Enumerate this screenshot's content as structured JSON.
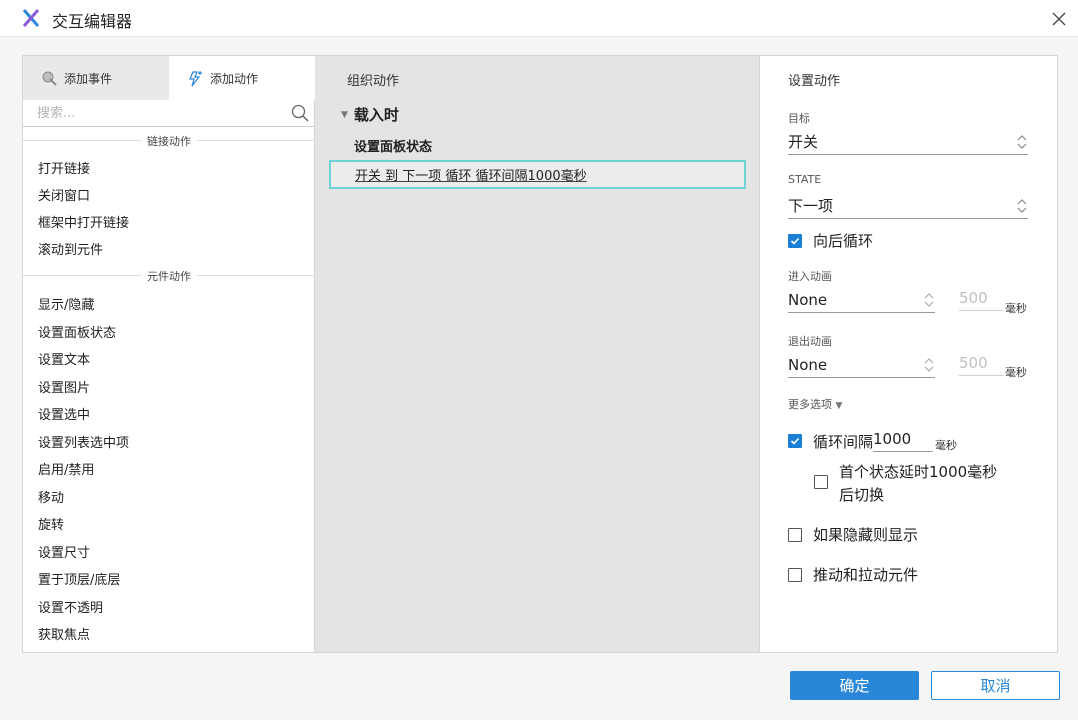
{
  "window": {
    "title": "交互编辑器"
  },
  "left": {
    "tabs": [
      {
        "label": "添加事件",
        "icon": "add-event-icon"
      },
      {
        "label": "添加动作",
        "icon": "add-action-icon"
      }
    ],
    "search_placeholder": "搜索...",
    "sections": [
      {
        "title": "链接动作",
        "items": [
          "打开链接",
          "关闭窗口",
          "框架中打开链接",
          "滚动到元件"
        ]
      },
      {
        "title": "元件动作",
        "items": [
          "显示/隐藏",
          "设置面板状态",
          "设置文本",
          "设置图片",
          "设置选中",
          "设置列表选中项",
          "启用/禁用",
          "移动",
          "旋转",
          "设置尺寸",
          "置于顶层/底层",
          "设置不透明",
          "获取焦点"
        ]
      }
    ]
  },
  "middle": {
    "title": "组织动作",
    "event": "载入时",
    "action_title": "设置面板状态",
    "action_detail": "开关 到 下一项 循环 循环间隔1000毫秒"
  },
  "right": {
    "title": "设置动作",
    "target_label": "目标",
    "target_value": "开关",
    "state_label": "STATE",
    "state_value": "下一项",
    "wrap_label": "向后循环",
    "enter_anim_label": "进入动画",
    "enter_anim_value": "None",
    "enter_duration": "500",
    "exit_anim_label": "退出动画",
    "exit_anim_value": "None",
    "exit_duration": "500",
    "unit_ms": "毫秒",
    "more_options": "更多选项",
    "loop_label": "循环间隔",
    "loop_value": "1000",
    "first_delay_line1": "首个状态延时1000毫秒",
    "first_delay_line2": "后切换",
    "show_if_hidden": "如果隐藏则显示",
    "push_pull": "推动和拉动元件"
  },
  "buttons": {
    "ok": "确定",
    "cancel": "取消"
  },
  "colors": {
    "accent": "#2a86d8",
    "selection_border": "#6fd3d6",
    "checkbox": "#1a7fd4"
  }
}
